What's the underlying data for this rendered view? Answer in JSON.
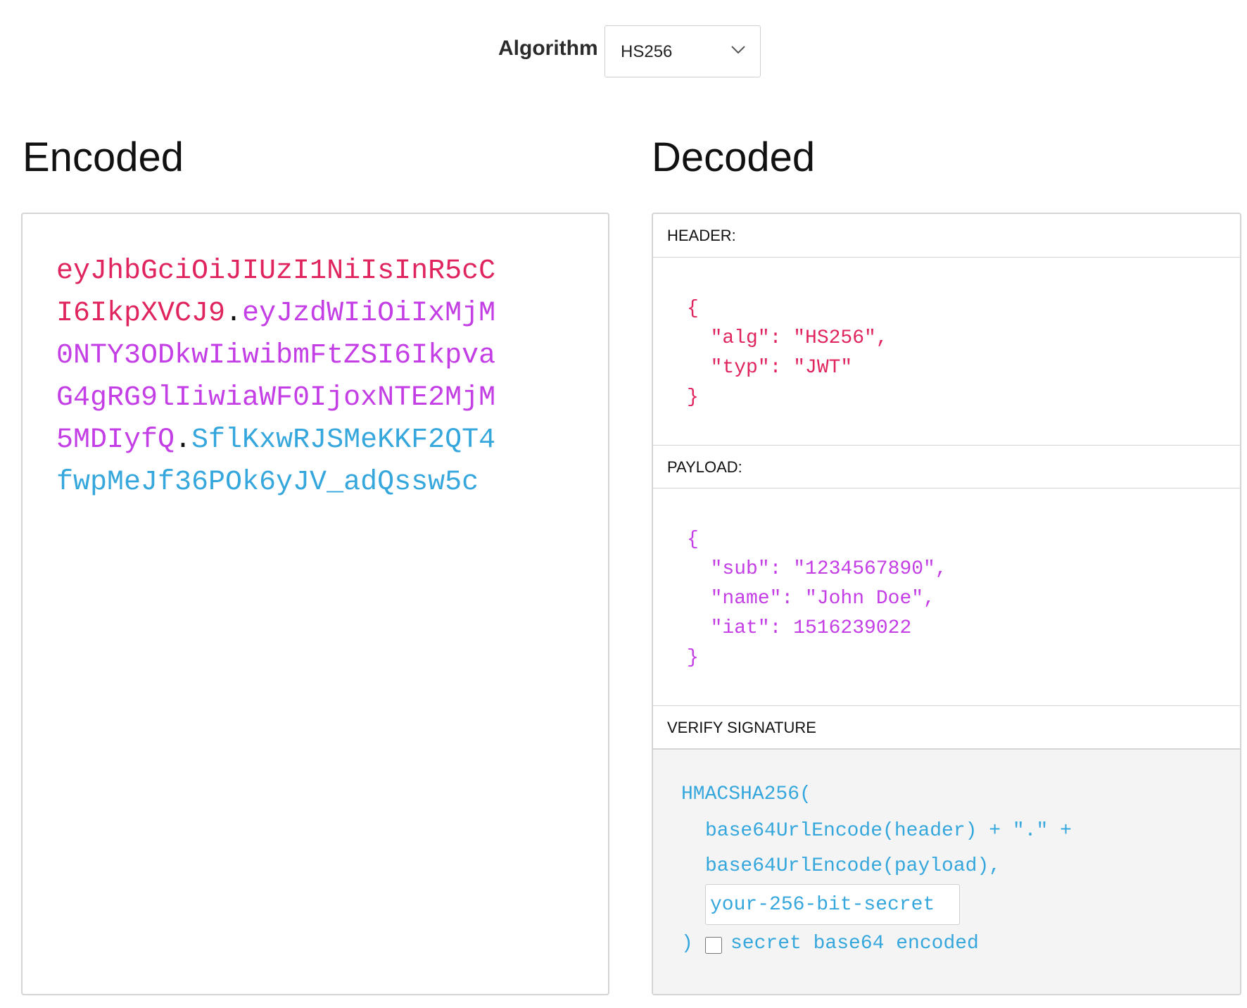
{
  "algorithm": {
    "label": "Algorithm",
    "selected": "HS256"
  },
  "encoded": {
    "heading": "Encoded",
    "lines": [
      [
        {
          "t": "eyJhbGciOiJIUzI1NiIsInR5cC",
          "c": "header"
        }
      ],
      [
        {
          "t": "I6IkpXVCJ9",
          "c": "header"
        },
        {
          "t": ".",
          "c": "dot"
        },
        {
          "t": "eyJzdWIiOiIxMjM",
          "c": "payload"
        }
      ],
      [
        {
          "t": "0NTY3ODkwIiwibmFtZSI6Ikpva",
          "c": "payload"
        }
      ],
      [
        {
          "t": "G4gRG9lIiwiaWF0IjoxNTE2MjM",
          "c": "payload"
        }
      ],
      [
        {
          "t": "5MDIyfQ",
          "c": "payload"
        },
        {
          "t": ".",
          "c": "dot"
        },
        {
          "t": "SflKxwRJSMeKKF2QT4",
          "c": "sig"
        }
      ],
      [
        {
          "t": "fwpMeJf36POk6yJV_adQssw5c",
          "c": "sig"
        }
      ]
    ]
  },
  "decoded": {
    "heading": "Decoded",
    "header": {
      "title": "HEADER:",
      "json": "{\n  \"alg\": \"HS256\",\n  \"typ\": \"JWT\"\n}"
    },
    "payload": {
      "title": "PAYLOAD:",
      "json": "{\n  \"sub\": \"1234567890\",\n  \"name\": \"John Doe\",\n  \"iat\": 1516239022\n}"
    },
    "verify": {
      "title": "VERIFY SIGNATURE",
      "fn_open": "HMACSHA256(",
      "line1": "base64UrlEncode(header) + \".\" +",
      "line2": "base64UrlEncode(payload),",
      "secret_placeholder": "your-256-bit-secret",
      "fn_close": ")",
      "checkbox_label": "secret base64 encoded",
      "checkbox_checked": false
    }
  },
  "colors": {
    "header": "#e0245e",
    "payload": "#c43ee6",
    "signature": "#35a7dc",
    "border": "#d4d4d4"
  }
}
